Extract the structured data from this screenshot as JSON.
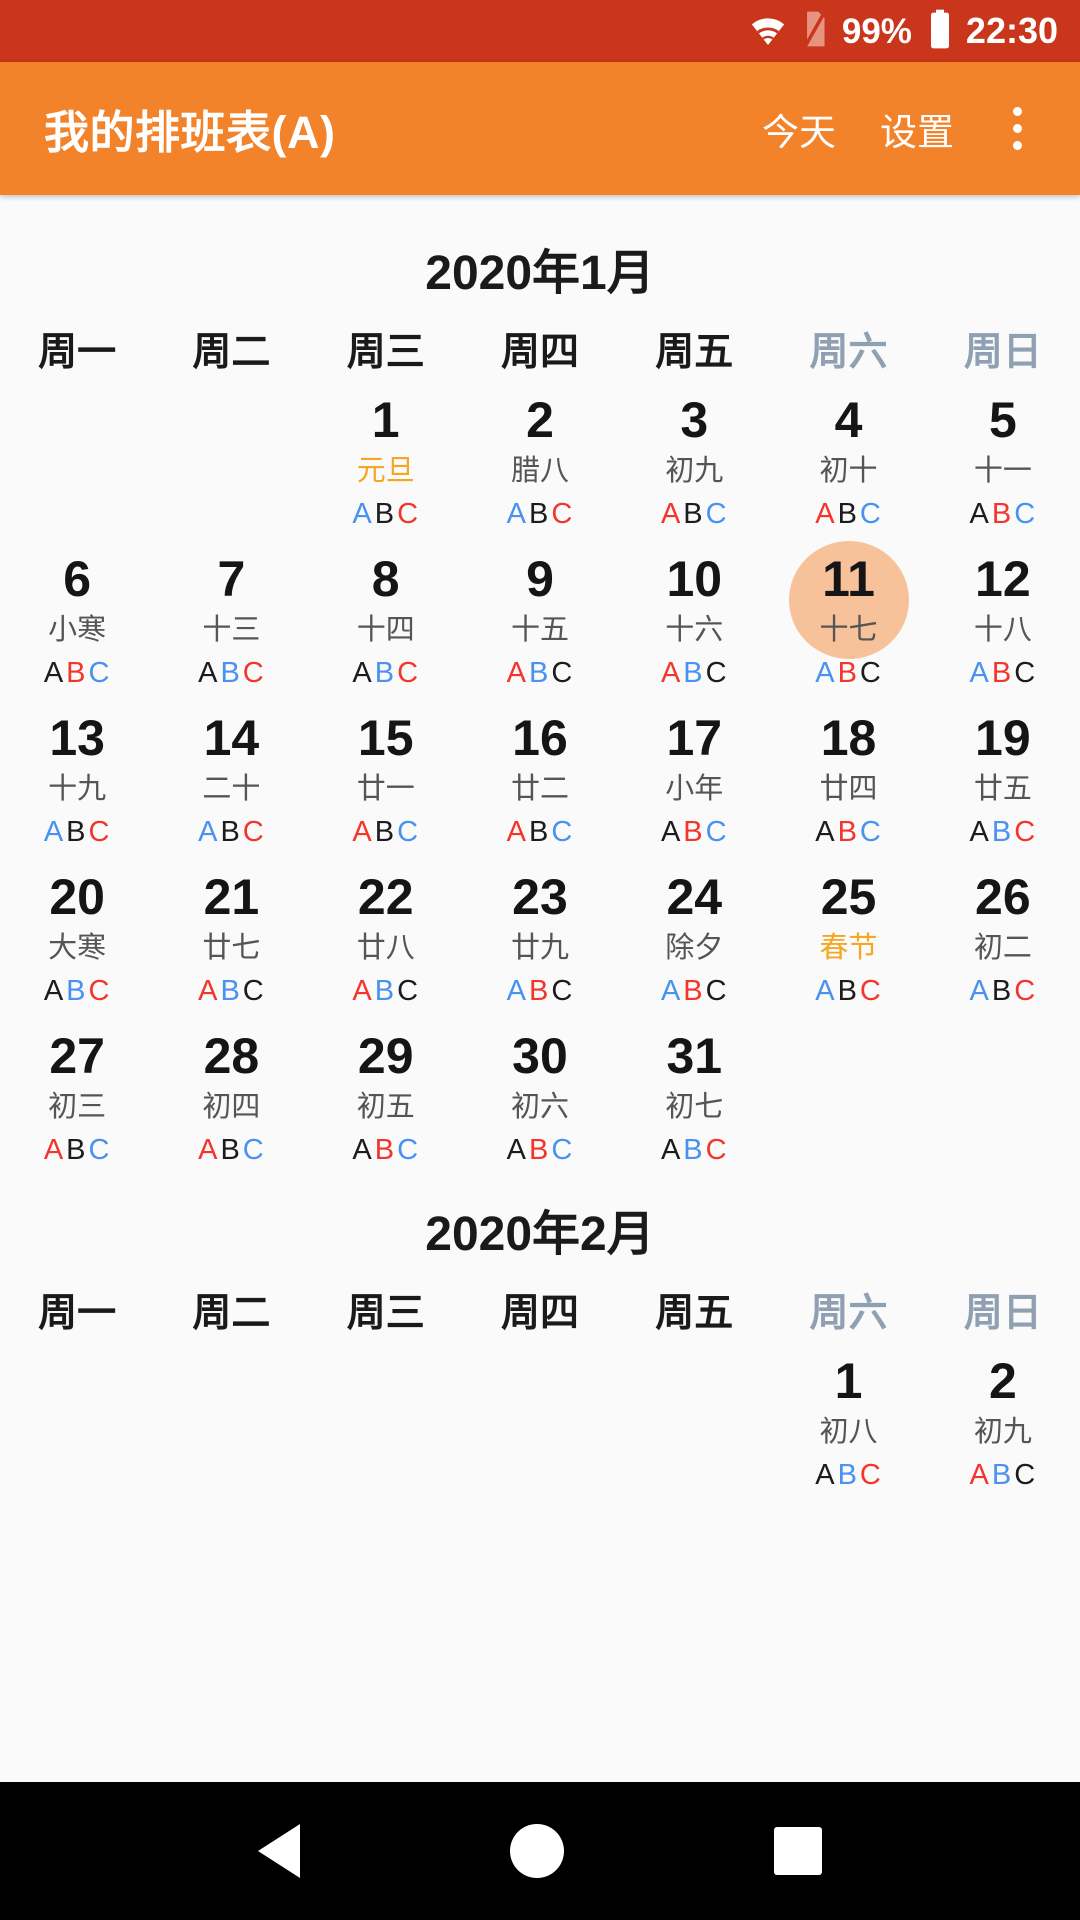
{
  "statusbar": {
    "wifi_icon": "wifi-icon",
    "sim_icon": "sim-card-off-icon",
    "battery_percent": "99%",
    "battery_icon": "battery-full-icon",
    "clock": "22:30"
  },
  "appbar": {
    "title": "我的排班表(A)",
    "today_label": "今天",
    "settings_label": "设置",
    "overflow_icon": "overflow-menu-icon"
  },
  "colors": {
    "statusbar_bg": "#c9361c",
    "appbar_bg": "#f2832b",
    "page_bg": "#fafafa",
    "today_highlight": "#f7c29a",
    "festival": "#f5a623",
    "weekend_header": "#8fa0b3",
    "shift_black": "#1c1c1c",
    "shift_red": "#f4352c",
    "shift_blue": "#4a92f0"
  },
  "weekdays": [
    {
      "label": "周一",
      "weekend": false
    },
    {
      "label": "周二",
      "weekend": false
    },
    {
      "label": "周三",
      "weekend": false
    },
    {
      "label": "周四",
      "weekend": false
    },
    {
      "label": "周五",
      "weekend": false
    },
    {
      "label": "周六",
      "weekend": true
    },
    {
      "label": "周日",
      "weekend": true
    }
  ],
  "shift_labels": [
    "A",
    "B",
    "C"
  ],
  "months": [
    {
      "title": "2020年1月",
      "weeks": [
        [
          null,
          null,
          {
            "day": "1",
            "lunar": "元旦",
            "festival": true,
            "shifts": [
              "blue",
              "black",
              "red"
            ]
          },
          {
            "day": "2",
            "lunar": "腊八",
            "festival": false,
            "shifts": [
              "blue",
              "black",
              "red"
            ]
          },
          {
            "day": "3",
            "lunar": "初九",
            "festival": false,
            "shifts": [
              "red",
              "black",
              "blue"
            ]
          },
          {
            "day": "4",
            "lunar": "初十",
            "festival": false,
            "shifts": [
              "red",
              "black",
              "blue"
            ]
          },
          {
            "day": "5",
            "lunar": "十一",
            "festival": false,
            "shifts": [
              "black",
              "red",
              "blue"
            ]
          }
        ],
        [
          {
            "day": "6",
            "lunar": "小寒",
            "festival": false,
            "shifts": [
              "black",
              "red",
              "blue"
            ]
          },
          {
            "day": "7",
            "lunar": "十三",
            "festival": false,
            "shifts": [
              "black",
              "blue",
              "red"
            ]
          },
          {
            "day": "8",
            "lunar": "十四",
            "festival": false,
            "shifts": [
              "black",
              "blue",
              "red"
            ]
          },
          {
            "day": "9",
            "lunar": "十五",
            "festival": false,
            "shifts": [
              "red",
              "blue",
              "black"
            ]
          },
          {
            "day": "10",
            "lunar": "十六",
            "festival": false,
            "shifts": [
              "red",
              "blue",
              "black"
            ]
          },
          {
            "day": "11",
            "lunar": "十七",
            "festival": false,
            "shifts": [
              "blue",
              "red",
              "black"
            ],
            "today": true
          },
          {
            "day": "12",
            "lunar": "十八",
            "festival": false,
            "shifts": [
              "blue",
              "red",
              "black"
            ]
          }
        ],
        [
          {
            "day": "13",
            "lunar": "十九",
            "festival": false,
            "shifts": [
              "blue",
              "black",
              "red"
            ]
          },
          {
            "day": "14",
            "lunar": "二十",
            "festival": false,
            "shifts": [
              "blue",
              "black",
              "red"
            ]
          },
          {
            "day": "15",
            "lunar": "廿一",
            "festival": false,
            "shifts": [
              "red",
              "black",
              "blue"
            ]
          },
          {
            "day": "16",
            "lunar": "廿二",
            "festival": false,
            "shifts": [
              "red",
              "black",
              "blue"
            ]
          },
          {
            "day": "17",
            "lunar": "小年",
            "festival": false,
            "shifts": [
              "black",
              "red",
              "blue"
            ]
          },
          {
            "day": "18",
            "lunar": "廿四",
            "festival": false,
            "shifts": [
              "black",
              "red",
              "blue"
            ]
          },
          {
            "day": "19",
            "lunar": "廿五",
            "festival": false,
            "shifts": [
              "black",
              "blue",
              "red"
            ]
          }
        ],
        [
          {
            "day": "20",
            "lunar": "大寒",
            "festival": false,
            "shifts": [
              "black",
              "blue",
              "red"
            ]
          },
          {
            "day": "21",
            "lunar": "廿七",
            "festival": false,
            "shifts": [
              "red",
              "blue",
              "black"
            ]
          },
          {
            "day": "22",
            "lunar": "廿八",
            "festival": false,
            "shifts": [
              "red",
              "blue",
              "black"
            ]
          },
          {
            "day": "23",
            "lunar": "廿九",
            "festival": false,
            "shifts": [
              "blue",
              "red",
              "black"
            ]
          },
          {
            "day": "24",
            "lunar": "除夕",
            "festival": false,
            "shifts": [
              "blue",
              "red",
              "black"
            ]
          },
          {
            "day": "25",
            "lunar": "春节",
            "festival": true,
            "shifts": [
              "blue",
              "black",
              "red"
            ]
          },
          {
            "day": "26",
            "lunar": "初二",
            "festival": false,
            "shifts": [
              "blue",
              "black",
              "red"
            ]
          }
        ],
        [
          {
            "day": "27",
            "lunar": "初三",
            "festival": false,
            "shifts": [
              "red",
              "black",
              "blue"
            ]
          },
          {
            "day": "28",
            "lunar": "初四",
            "festival": false,
            "shifts": [
              "red",
              "black",
              "blue"
            ]
          },
          {
            "day": "29",
            "lunar": "初五",
            "festival": false,
            "shifts": [
              "black",
              "red",
              "blue"
            ]
          },
          {
            "day": "30",
            "lunar": "初六",
            "festival": false,
            "shifts": [
              "black",
              "red",
              "blue"
            ]
          },
          {
            "day": "31",
            "lunar": "初七",
            "festival": false,
            "shifts": [
              "black",
              "blue",
              "red"
            ]
          },
          null,
          null
        ]
      ]
    },
    {
      "title": "2020年2月",
      "weeks": [
        [
          null,
          null,
          null,
          null,
          null,
          {
            "day": "1",
            "lunar": "初八",
            "festival": false,
            "shifts": [
              "black",
              "blue",
              "red"
            ]
          },
          {
            "day": "2",
            "lunar": "初九",
            "festival": false,
            "shifts": [
              "red",
              "blue",
              "black"
            ]
          }
        ]
      ]
    }
  ],
  "navbar": {
    "back_icon": "back-triangle-icon",
    "home_icon": "home-circle-icon",
    "recents_icon": "recents-square-icon"
  }
}
